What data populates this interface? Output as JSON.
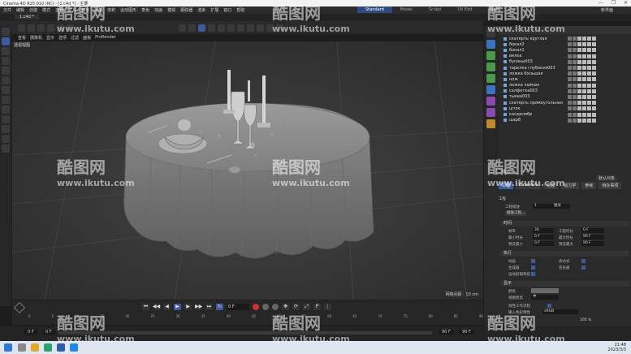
{
  "window": {
    "title": "Cinema 4D R25.010 (RC) - [1.c4d *] - 主要",
    "controls": [
      "—",
      "❐",
      "✕"
    ]
  },
  "menu": {
    "items": [
      "文件",
      "编辑",
      "创建",
      "模式",
      "选择",
      "工具",
      "样条",
      "网格",
      "体积",
      "运动图形",
      "角色",
      "动画",
      "模拟",
      "跟踪器",
      "渲染",
      "扩展",
      "窗口",
      "帮助"
    ],
    "layouts": [
      "Standard",
      "Model",
      "Sculpt",
      "UV Edit",
      "Paint"
    ],
    "new_interface": "新界面"
  },
  "document_tab": "1.c4d *",
  "viewport_menu": [
    "查看",
    "摄像机",
    "显示",
    "选项",
    "过滤",
    "面板",
    "ProRender"
  ],
  "viewport": {
    "label": "透视视图",
    "grid_status": "网格间距 : 10 cm"
  },
  "objects": [
    {
      "name": "скатерть круглая"
    },
    {
      "name": "бокал2"
    },
    {
      "name": "бокал1"
    },
    {
      "name": "вилка"
    },
    {
      "name": "бусины003"
    },
    {
      "name": "тарелка глубокая003"
    },
    {
      "name": "ложка большая"
    },
    {
      "name": "нож"
    },
    {
      "name": "ложка чайная"
    },
    {
      "name": "салфетка003"
    },
    {
      "name": "тыква003"
    },
    {
      "name": "скатерть прямоугольная"
    },
    {
      "name": "шток"
    },
    {
      "name": "канделябр"
    },
    {
      "name": "шар8"
    }
  ],
  "attributes": {
    "mode_label": "模式",
    "tabs": [
      "工程",
      "Cineware",
      "信息",
      "动力学",
      "参考",
      "待办事项",
      "插值",
      "XRefs"
    ],
    "sections": {
      "project": "工程",
      "time": "时间",
      "execute": "执行",
      "display": "显示"
    },
    "project_scale_label": "工程缩放",
    "project_scale_value": "1",
    "project_scale_unit": "厘米",
    "scale_button": "缩放工程...",
    "fps_label": "帧率",
    "fps_value": "30",
    "project_time_label": "工程时长",
    "project_time_value": "0 F",
    "min_time_label": "最小时长",
    "min_time_value": "0 F",
    "max_time_label": "最大时长",
    "max_time_value": "90 F",
    "preview_min_label": "预览最小",
    "preview_min_value": "0 F",
    "preview_max_label": "预览最大",
    "preview_max_value": "90 F",
    "animation_label": "动画",
    "expression_label": "表达式",
    "generator_label": "生成器",
    "deformer_label": "变形器",
    "motion_system_label": "运动剪辑系统",
    "color_label": "颜色",
    "view_clip_label": "视图修剪",
    "view_clip_value": "中",
    "linear_workflow_label": "线性工作流程",
    "input_color_label": "输入色彩特性",
    "input_color_value": "sRGB",
    "zoom_value": "100 %",
    "default_object": "默认对象"
  },
  "timeline": {
    "current_frame": "0 F",
    "ruler": [
      "0",
      "5",
      "10",
      "15",
      "20",
      "25",
      "30",
      "35",
      "40",
      "45",
      "50",
      "55",
      "60",
      "65",
      "70",
      "75",
      "80",
      "85",
      "90"
    ],
    "start_field": "0 F",
    "end_field": "90 F",
    "end_field2": "90 F",
    "start_field2": "0 F"
  },
  "taskbar": {
    "time": "21:48",
    "date": "2023/3/3"
  },
  "watermark": {
    "brand": "酷图网",
    "url": "www.ikutu.com"
  },
  "colors": {
    "accent": "#3d5a9a",
    "active_layout": "#2f4b80",
    "viewport_bg": "#3a3a3a",
    "object_icon": "#7aa3d8"
  }
}
